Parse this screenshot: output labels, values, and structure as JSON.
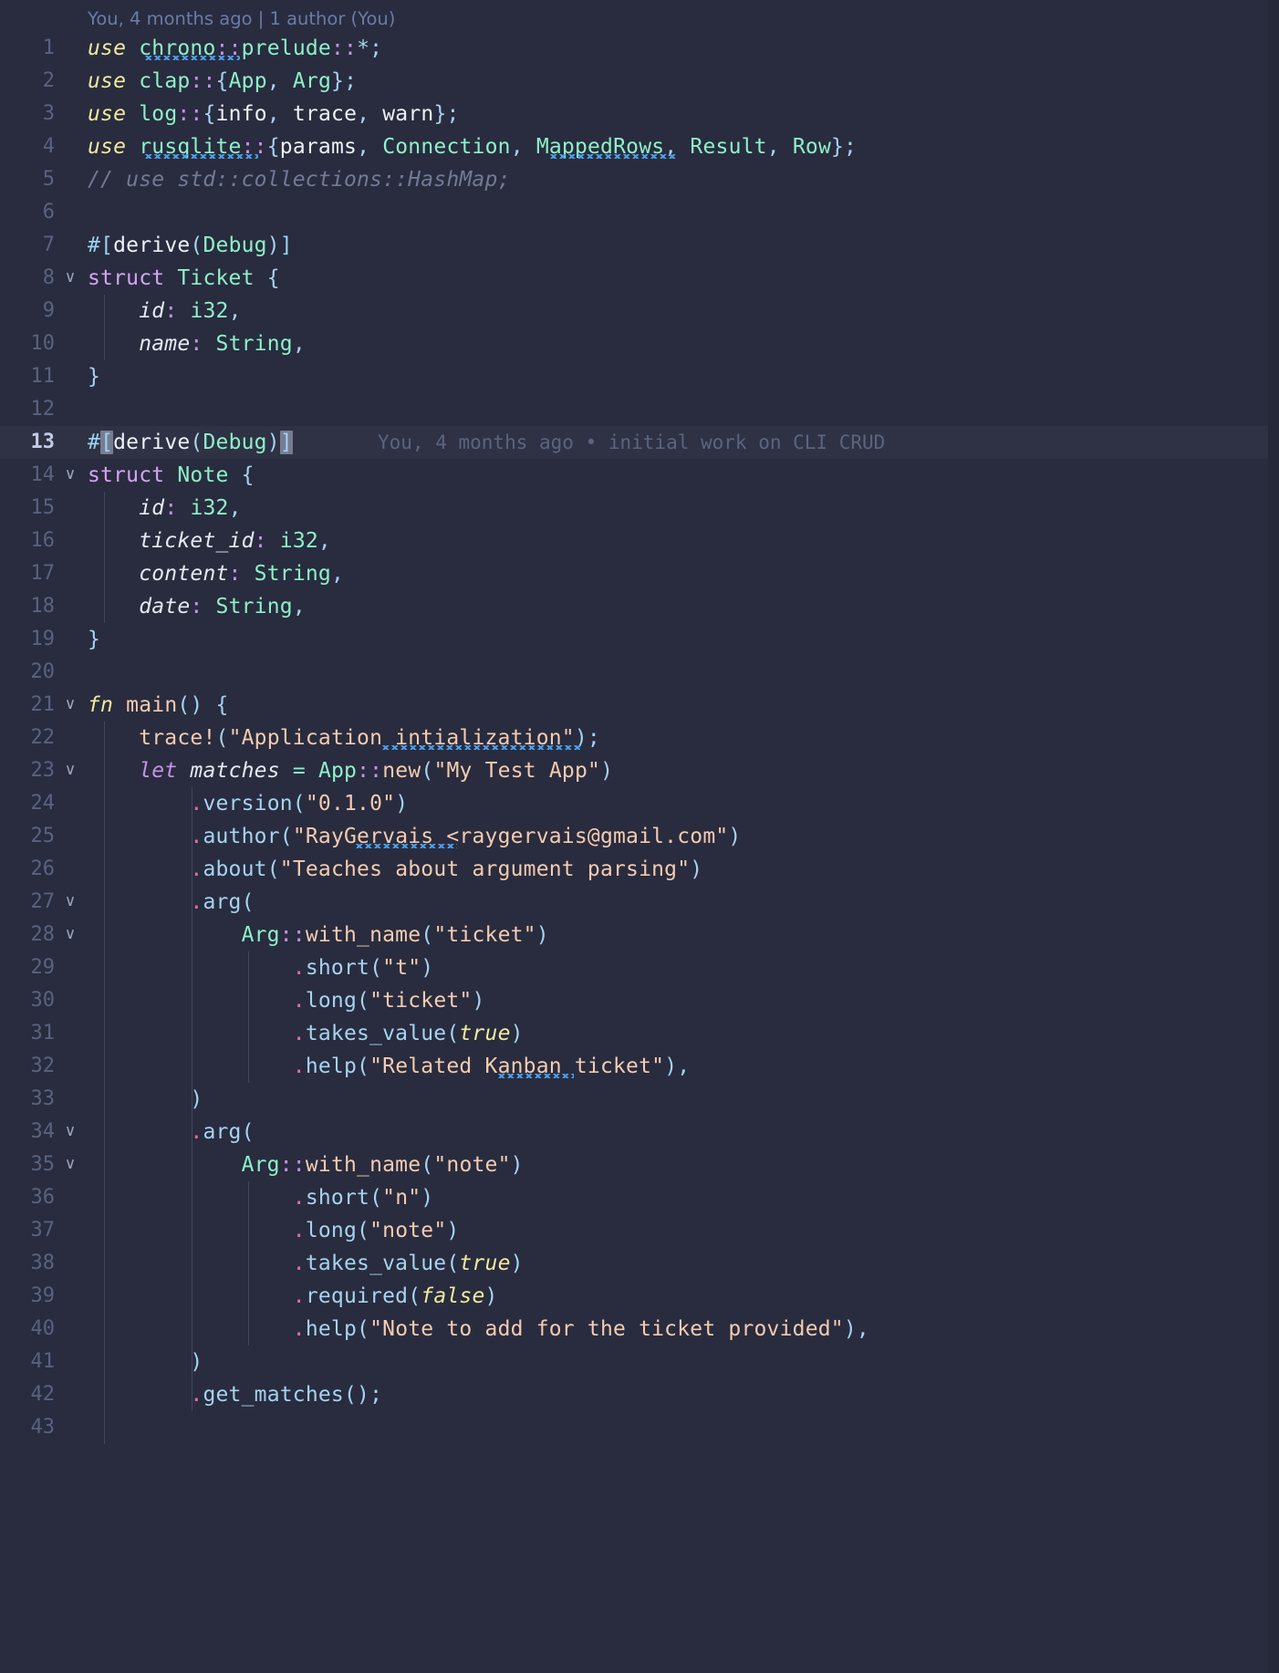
{
  "editor": {
    "background": "#282c3e",
    "active_line_background": "#2e3244",
    "gutter_color": "#59627f",
    "accent_blue": "#4a9eea"
  },
  "blame_header": {
    "text": "You, 4 months ago | 1 author (You)"
  },
  "inline_blame": {
    "line": 13,
    "text": "You, 4 months ago • initial work on CLI CRUD"
  },
  "active_line": 13,
  "fold_markers": {
    "icon": "chevron-down-icon",
    "glyph": "∨",
    "lines": [
      8,
      14,
      21,
      23,
      27,
      28,
      34,
      35
    ]
  },
  "lines": [
    {
      "n": 1,
      "text": "use chrono::prelude::*;"
    },
    {
      "n": 2,
      "text": "use clap::{App, Arg};"
    },
    {
      "n": 3,
      "text": "use log::{info, trace, warn};"
    },
    {
      "n": 4,
      "text": "use rusqlite::{params, Connection, MappedRows, Result, Row};"
    },
    {
      "n": 5,
      "text": "// use std::collections::HashMap;"
    },
    {
      "n": 6,
      "text": ""
    },
    {
      "n": 7,
      "text": "#[derive(Debug)]"
    },
    {
      "n": 8,
      "text": "struct Ticket {"
    },
    {
      "n": 9,
      "text": "    id: i32,"
    },
    {
      "n": 10,
      "text": "    name: String,"
    },
    {
      "n": 11,
      "text": "}"
    },
    {
      "n": 12,
      "text": ""
    },
    {
      "n": 13,
      "text": "#[derive(Debug)]"
    },
    {
      "n": 14,
      "text": "struct Note {"
    },
    {
      "n": 15,
      "text": "    id: i32,"
    },
    {
      "n": 16,
      "text": "    ticket_id: i32,"
    },
    {
      "n": 17,
      "text": "    content: String,"
    },
    {
      "n": 18,
      "text": "    date: String,"
    },
    {
      "n": 19,
      "text": "}"
    },
    {
      "n": 20,
      "text": ""
    },
    {
      "n": 21,
      "text": "fn main() {"
    },
    {
      "n": 22,
      "text": "    trace!(\"Application intialization\");"
    },
    {
      "n": 23,
      "text": "    let matches = App::new(\"My Test App\")"
    },
    {
      "n": 24,
      "text": "        .version(\"0.1.0\")"
    },
    {
      "n": 25,
      "text": "        .author(\"RayGervais <raygervais@gmail.com\")"
    },
    {
      "n": 26,
      "text": "        .about(\"Teaches about argument parsing\")"
    },
    {
      "n": 27,
      "text": "        .arg("
    },
    {
      "n": 28,
      "text": "            Arg::with_name(\"ticket\")"
    },
    {
      "n": 29,
      "text": "                .short(\"t\")"
    },
    {
      "n": 30,
      "text": "                .long(\"ticket\")"
    },
    {
      "n": 31,
      "text": "                .takes_value(true)"
    },
    {
      "n": 32,
      "text": "                .help(\"Related Kanban ticket\"),"
    },
    {
      "n": 33,
      "text": "        )"
    },
    {
      "n": 34,
      "text": "        .arg("
    },
    {
      "n": 35,
      "text": "            Arg::with_name(\"note\")"
    },
    {
      "n": 36,
      "text": "                .short(\"n\")"
    },
    {
      "n": 37,
      "text": "                .long(\"note\")"
    },
    {
      "n": 38,
      "text": "                .takes_value(true)"
    },
    {
      "n": 39,
      "text": "                .required(false)"
    },
    {
      "n": 40,
      "text": "                .help(\"Note to add for the ticket provided\"),"
    },
    {
      "n": 41,
      "text": "        )"
    },
    {
      "n": 42,
      "text": "        .get_matches();"
    },
    {
      "n": 43,
      "text": ""
    }
  ],
  "spellcheck_words": [
    {
      "line": 1,
      "word": "chrono"
    },
    {
      "line": 4,
      "word": "rusqlite"
    },
    {
      "line": 4,
      "word": "MappedRows"
    },
    {
      "line": 22,
      "word": "intialization"
    },
    {
      "line": 25,
      "word": "raygervais"
    },
    {
      "line": 32,
      "word": "Kanban"
    }
  ]
}
